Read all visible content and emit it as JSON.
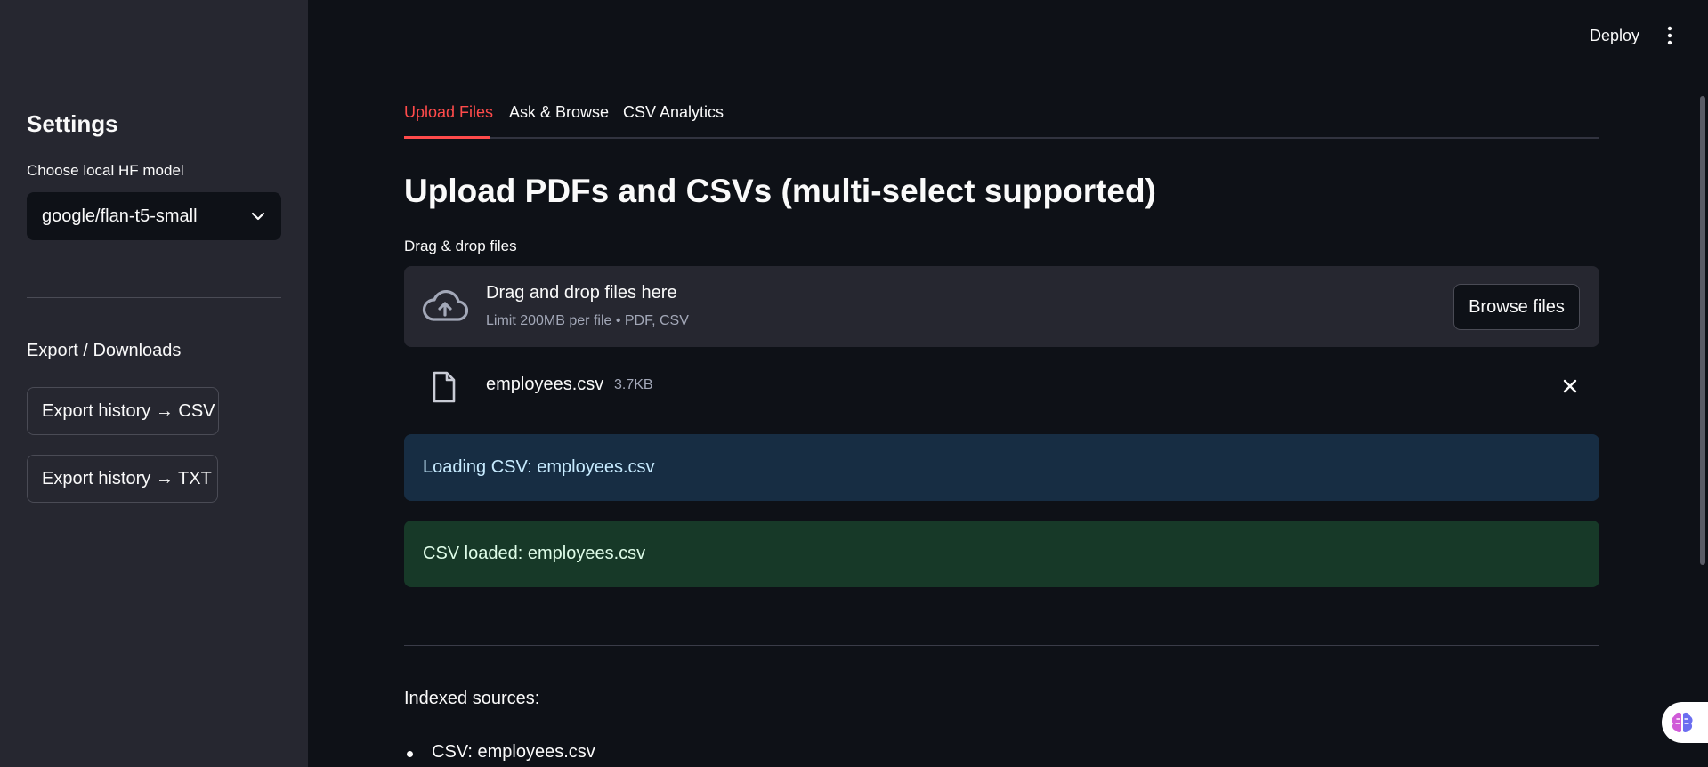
{
  "sidebar": {
    "title": "Settings",
    "model_label": "Choose local HF model",
    "model_value": "google/flan-t5-small",
    "export_section": "Export / Downloads",
    "export_csv": "Export history → CSV",
    "export_txt": "Export history → TXT"
  },
  "header": {
    "deploy": "Deploy",
    "menu_icon": "kebab-menu-icon"
  },
  "tabs": [
    {
      "label": "Upload Files",
      "active": true
    },
    {
      "label": "Ask & Browse",
      "active": false
    },
    {
      "label": "CSV Analytics",
      "active": false
    }
  ],
  "main": {
    "heading": "Upload PDFs and CSVs (multi-select supported)",
    "uploader_label": "Drag & drop files",
    "dropzone_title": "Drag and drop files here",
    "dropzone_sub": "Limit 200MB per file • PDF, CSV",
    "browse_label": "Browse files",
    "file": {
      "name": "employees.csv",
      "size": "3.7KB"
    },
    "info_alert": "Loading CSV: employees.csv",
    "success_alert": "CSV loaded: employees.csv",
    "indexed_label": "Indexed sources:",
    "indexed_items": [
      "CSV: employees.csv"
    ]
  },
  "colors": {
    "accent": "#ff4b4b",
    "background": "#0e1117",
    "sidebar": "#262730",
    "info_bg": "#172d43",
    "success_bg": "#173928"
  }
}
